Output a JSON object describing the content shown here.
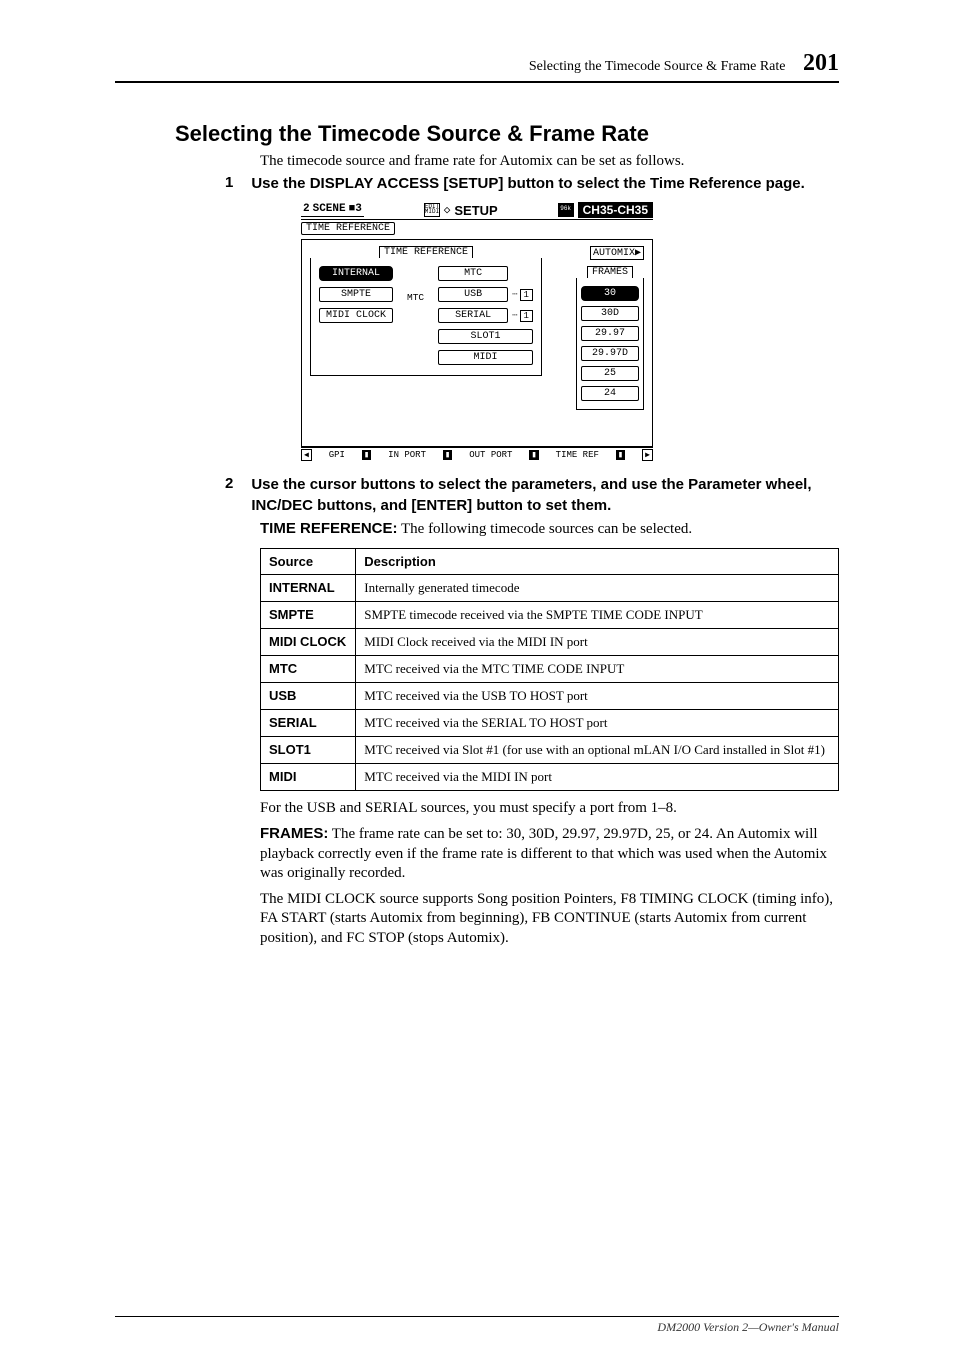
{
  "header": {
    "section_title": "Selecting the Timecode Source & Frame Rate",
    "page_number": "201"
  },
  "h2": "Selecting the Timecode Source & Frame Rate",
  "intro": "The timecode source and frame rate for Automix can be set as follows.",
  "step1": {
    "num": "1",
    "text": "Use the DISPLAY ACCESS [SETUP] button to select the Time Reference page."
  },
  "lcd": {
    "scene_num": "2",
    "scene_label": "SCENE",
    "scene_value": "■3",
    "top_icon_label": "EDIT MIDI",
    "setup_glyph": "◇",
    "setup_label": "SETUP",
    "ch_label": "CH35-CH35",
    "tab_time_reference": "TIME REFERENCE",
    "group_time_reference": "TIME REFERENCE",
    "automix_label": "AUTOMIX▶",
    "frames_label": "FRAMES",
    "left_col": [
      "INTERNAL",
      "SMPTE",
      "MIDI CLOCK"
    ],
    "mtc_label": "MTC",
    "right_col": [
      "MTC",
      "USB",
      "SERIAL",
      "SLOT1",
      "MIDI"
    ],
    "port_usb": "1",
    "port_serial": "1",
    "frames": [
      "30",
      "30D",
      "29.97",
      "29.97D",
      "25",
      "24"
    ],
    "frames_selected": "30",
    "tabs": {
      "left_arrow": "◀",
      "items": [
        "GPI",
        "IN PORT",
        "OUT PORT",
        "TIME REF"
      ],
      "right_arrow": "▶"
    }
  },
  "step2": {
    "num": "2",
    "text": "Use the cursor buttons to select the parameters, and use the Parameter wheel, INC/DEC buttons, and [ENTER] button to set them."
  },
  "time_reference_line": {
    "label": "TIME REFERENCE:",
    "rest": " The following timecode sources can be selected."
  },
  "table": {
    "headers": [
      "Source",
      "Description"
    ],
    "rows": [
      [
        "INTERNAL",
        "Internally generated timecode"
      ],
      [
        "SMPTE",
        "SMPTE timecode received via the SMPTE TIME CODE INPUT"
      ],
      [
        "MIDI CLOCK",
        "MIDI Clock received via the MIDI IN port"
      ],
      [
        "MTC",
        "MTC received via the MTC TIME CODE INPUT"
      ],
      [
        "USB",
        "MTC received via the USB TO HOST port"
      ],
      [
        "SERIAL",
        "MTC received via the SERIAL TO HOST port"
      ],
      [
        "SLOT1",
        "MTC received via Slot #1 (for use with an optional mLAN I/O Card installed in Slot #1)"
      ],
      [
        "MIDI",
        "MTC received via the MIDI IN port"
      ]
    ]
  },
  "post_table_1": "For the USB and SERIAL sources, you must specify a port from 1–8.",
  "frames_para": {
    "label": "FRAMES:",
    "rest": " The frame rate can be set to: 30, 30D, 29.97, 29.97D, 25, or 24. An Automix will playback correctly even if the frame rate is different to that which was used when the Automix was originally recorded."
  },
  "midi_clock_para": "The MIDI CLOCK source supports Song position Pointers, F8 TIMING CLOCK (timing info), FA START (starts Automix from beginning), FB CONTINUE (starts Automix from current position), and FC STOP (stops Automix).",
  "footer": "DM2000 Version 2—Owner's Manual"
}
